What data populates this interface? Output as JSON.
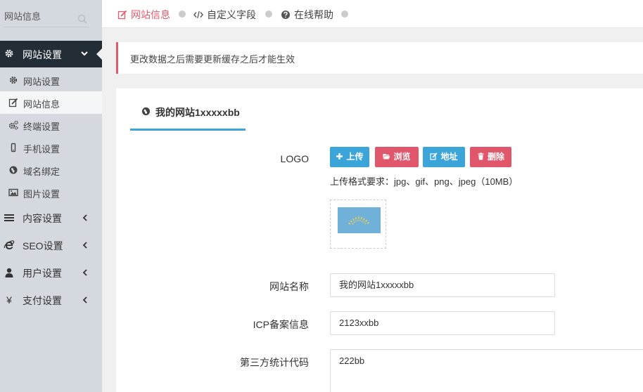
{
  "sidebar": {
    "search_text": "网站信息",
    "active_group": "网站设置",
    "sub_items": [
      {
        "label": "网站设置",
        "icon": "gear-icon"
      },
      {
        "label": "网站信息",
        "icon": "edit-icon",
        "active": true
      },
      {
        "label": "终端设置",
        "icon": "cogs-icon"
      },
      {
        "label": "手机设置",
        "icon": "mobile-icon"
      },
      {
        "label": "域名绑定",
        "icon": "globe-icon"
      },
      {
        "label": "图片设置",
        "icon": "image-icon"
      }
    ],
    "groups": [
      {
        "label": "内容设置",
        "icon": "list-icon"
      },
      {
        "label": "SEO设置",
        "icon": "ie-icon"
      },
      {
        "label": "用户设置",
        "icon": "user-icon"
      },
      {
        "label": "支付设置",
        "icon": "yen-icon"
      }
    ]
  },
  "tabs": [
    {
      "label": "网站信息",
      "icon": "edit-icon",
      "active": true
    },
    {
      "label": "自定义字段",
      "icon": "code-icon"
    },
    {
      "label": "在线帮助",
      "icon": "question-icon"
    }
  ],
  "alert": "更改数据之后需要更新缓存之后才能生效",
  "panel": {
    "tab_label": "我的网站1xxxxxbb",
    "logo_label": "LOGO",
    "buttons": {
      "upload": "上传",
      "browse": "浏览",
      "address": "地址",
      "delete": "删除"
    },
    "upload_hint": "上传格式要求：jpg、gif、png、jpeg（10MB）",
    "fields": {
      "site_name_label": "网站名称",
      "site_name_value": "我的网站1xxxxxbb",
      "icp_label": "ICP备案信息",
      "icp_value": "2123xxbb",
      "stats_label": "第三方统计代码",
      "stats_value": "222bb"
    }
  },
  "colors": {
    "accent_red": "#e05b6d",
    "accent_blue": "#3ba4d8",
    "sidebar_dark": "#232d36"
  }
}
